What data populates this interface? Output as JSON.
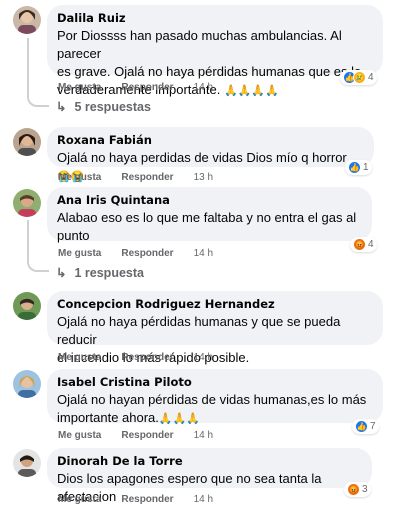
{
  "actions": {
    "like": "Me gusta",
    "reply": "Responder"
  },
  "comments": [
    {
      "author": "Dalila Ruiz",
      "lines": [
        "Por Diossss han pasado muchas ambulancias. Al parecer",
        "es grave. Ojalá no haya pérdidas humanas que es lo",
        "verdaderamente importante"
      ],
      "emoji": "🙏🙏🙏🙏",
      "time": "14 h",
      "reaction_count": "4",
      "replies": "5 respuestas"
    },
    {
      "author": "Roxana Fabián",
      "lines": [
        "Ojalá no haya perdidas de vidas Dios mío q horror"
      ],
      "emoji": "😭😭",
      "time": "13 h",
      "reaction_count": "1"
    },
    {
      "author": "Ana Iris Quintana",
      "lines": [
        "Alabao eso es lo que me faltaba y no entra el gas al",
        "punto"
      ],
      "time": "14 h",
      "reaction_count": "4",
      "replies": "1 respuesta"
    },
    {
      "author": "Concepcion Rodriguez Hernandez",
      "lines": [
        "Ojalá no haya pérdidas humanas y que se pueda reducir",
        "el incendio lo más rápido posible."
      ],
      "time": "14 h"
    },
    {
      "author": "Isabel Cristina Piloto",
      "lines": [
        "Ojalá no hayan pérdidas de vidas humanas,es lo más",
        "importante ahora."
      ],
      "emoji": "🙏🙏🙏",
      "time": "14 h",
      "reaction_count": "7"
    },
    {
      "author": "Dinorah De la Torre",
      "lines": [
        "Dios los apagones espero que no sea tanta la afectacion"
      ],
      "time": "14 h",
      "reaction_count": "3"
    }
  ]
}
